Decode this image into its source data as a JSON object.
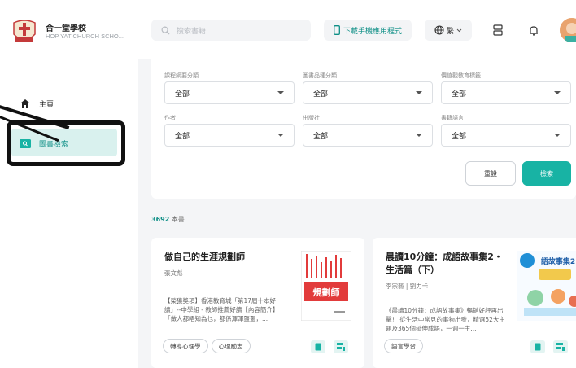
{
  "header": {
    "school_name": "合一堂學校",
    "school_sub": "HOP YAT CHURCH SCHO...",
    "search_placeholder": "搜索書籍",
    "download_label": "下載手機應用程式",
    "lang_label": "繁",
    "accent": "#18b3a4"
  },
  "sidebar": {
    "items": [
      {
        "label": "主頁",
        "icon": "home-icon"
      },
      {
        "label": "圖書檢索",
        "icon": "book-search-icon"
      }
    ]
  },
  "filters": [
    {
      "label": "課程綱要分類",
      "value": "全部"
    },
    {
      "label": "圖書品種分類",
      "value": "全部"
    },
    {
      "label": "價值觀教育標籤",
      "value": "全部"
    },
    {
      "label": "作者",
      "value": "全部"
    },
    {
      "label": "出版社",
      "value": "全部"
    },
    {
      "label": "書籍語言",
      "value": "全部"
    }
  ],
  "buttons": {
    "reset": "重設",
    "search": "檢索"
  },
  "results": {
    "count": "3692",
    "unit": " 本書"
  },
  "books": [
    {
      "title": "做自己的生涯規劃師",
      "author": "張文彪",
      "desc": "【榮獲獎項】香港教育城「第17屆十本好讀」--中學組 - 教師推薦好讀【內容簡介】「做人都唔知為乜，都係渾渾噩噩，...",
      "tags": [
        "轉導心理學",
        "心理勵志"
      ],
      "cover_text": "規劃師"
    },
    {
      "title": "晨讀10分鐘：成語故事集2・生活篇（下）",
      "author": "李宗藝 | 劉力卡",
      "desc": "《晨讀10分鐘：成語故事集》暢銷好評再出擊！ 從生活中常見的事物出發，精選52大主題及365個延伸成語，一週一主...",
      "tags": [
        "語言學習"
      ],
      "cover_text": "語故事集2"
    }
  ]
}
